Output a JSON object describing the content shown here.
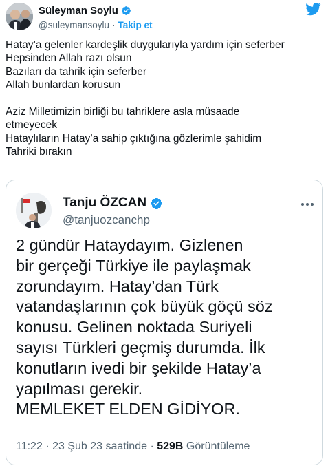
{
  "author": {
    "name": "Süleyman Soylu",
    "handle": "@suleymansoylu",
    "separator": "·",
    "follow_label": "Takip et"
  },
  "tweet": {
    "lines": [
      "Hatay’a gelenler kardeşlik duygularıyla yardım için seferber",
      "Hepsinden Allah razı olsun",
      "Bazıları da tahrik için seferber",
      "Allah bunlardan korusun",
      "",
      "Aziz Milletimizin birliği bu tahriklere asla müsaade",
      "etmeyecek",
      "Hataylıların Hatay’a sahip çıktığına gözlerimle şahidim",
      "Tahriki bırakın"
    ]
  },
  "quoted_tweet": {
    "name": "Tanju ÖZCAN",
    "handle": "@tanjuozcanchp",
    "lines": [
      "2 gündür Hataydayım. Gizlenen",
      "bir gerçeği Türkiye ile paylaşmak",
      "zorundayım. Hatay’dan Türk",
      "vatandaşlarının çok büyük göçü söz",
      "konusu. Gelinen noktada Suriyeli",
      "sayısı Türkleri geçmiş durumda. İlk",
      "konutların ivedi bir şekilde Hatay’a",
      "yapılması gerekir.",
      "MEMLEKET ELDEN GİDİYOR."
    ],
    "meta": {
      "time": "11:22",
      "separator": "·",
      "date": "23 Şub 23 saatinde",
      "views_count": "529B",
      "views_label": "Görüntüleme"
    }
  },
  "icons": {
    "verified": "verified-badge-icon",
    "twitter": "twitter-bird-icon",
    "more": "more-options-icon"
  },
  "colors": {
    "accent": "#1d9bf0",
    "text": "#0f1419",
    "muted": "#536471",
    "border": "#cfd9de"
  }
}
